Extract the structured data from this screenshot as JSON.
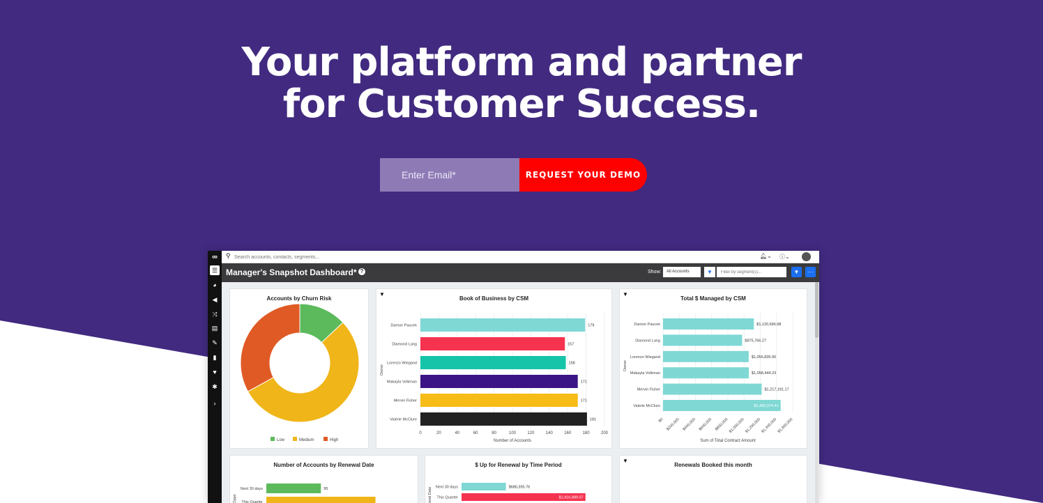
{
  "hero": {
    "title_line1": "Your platform and partner",
    "title_line2": "for Customer Success.",
    "email_placeholder": "Enter Email*",
    "cta_label": "REQUEST YOUR DEMO"
  },
  "colors": {
    "background": "#412a7f",
    "cta": "#ff0000",
    "email_bg": "#8e7bb6"
  },
  "app": {
    "search_placeholder": "Search accounts, contacts, segments...",
    "dashboard_title": "Manager's Snapshot Dashboard*",
    "show_label": "Show:",
    "show_select": "All Accounts",
    "segment_placeholder": "Filter by segment(s)...",
    "help_icon": "?",
    "topbar_icons": [
      "bell-icon",
      "question-icon",
      "avatar"
    ],
    "sidebar_icons": [
      "menu-icon",
      "dashboard-icon",
      "megaphone-icon",
      "shuffle-icon",
      "signpost-icon",
      "wrench-icon",
      "document-icon",
      "heart-icon",
      "gear-icon",
      "chevron-right-icon"
    ]
  },
  "panels": {
    "churn": {
      "title": "Accounts by Churn Risk"
    },
    "book": {
      "title": "Book of Business by CSM"
    },
    "managed": {
      "title": "Total $ Managed by CSM"
    },
    "renewal_date": {
      "title": "Number of Accounts by Renewal Date"
    },
    "renewal_period": {
      "title": "$ Up for Renewal by Time Period"
    },
    "booked": {
      "title": "Renewals Booked this month"
    }
  },
  "chart_data": [
    {
      "type": "pie",
      "title": "Accounts by Churn Risk",
      "categories": [
        "Low",
        "Medium",
        "High"
      ],
      "values": [
        13,
        54,
        33
      ],
      "colors": [
        "#5cba5c",
        "#f0b518",
        "#e05a25"
      ],
      "legend": "bottom"
    },
    {
      "type": "bar",
      "orientation": "horizontal",
      "title": "Book of Business by CSM",
      "categories": [
        "Damon Paucek",
        "Diamond Lang",
        "Lorenzo Wiegand",
        "Makayla Volkman",
        "Mervin Fisher",
        "Valerie McClure"
      ],
      "values": [
        179,
        157,
        158,
        171,
        171,
        181
      ],
      "colors": [
        "#7fd8d4",
        "#f5334f",
        "#16c5a9",
        "#3b1585",
        "#f7bc15",
        "#222222"
      ],
      "xlabel": "Number of Accounts",
      "ylabel": "Owner",
      "xlim": [
        0,
        200
      ],
      "xticks": [
        "0",
        "20",
        "40",
        "60",
        "80",
        "100",
        "120",
        "140",
        "160",
        "180",
        "200"
      ]
    },
    {
      "type": "bar",
      "orientation": "horizontal",
      "title": "Total $ Managed by CSM",
      "categories": [
        "Damon Paucek",
        "Diamond Lang",
        "Lorenzo Wiegand",
        "Makayla Volkman",
        "Mervin Fisher",
        "Valerie McClure"
      ],
      "values": [
        1120696.68,
        975766.27,
        1056839.9,
        1058444.23,
        1217191.17,
        1450974.41
      ],
      "value_labels": [
        "$1,120,696.68",
        "$975,766.27",
        "$1,056,839.90",
        "$1,058,444.23",
        "$1,217,191.17",
        "$1,450,974.41"
      ],
      "color": "#7fd8d4",
      "xlabel": "Sum of Total Contract Amount",
      "ylabel": "Owner",
      "xlim": [
        0,
        1600000
      ],
      "xticks": [
        "$0",
        "$200,000",
        "$400,000",
        "$600,000",
        "$800,000",
        "$1,000,000",
        "$1,200,000",
        "$1,400,000",
        "$1,600,000"
      ]
    },
    {
      "type": "bar",
      "orientation": "horizontal",
      "title": "Number of Accounts by Renewal Date",
      "categories": [
        "Next 30 days",
        "This Quarter"
      ],
      "values": [
        95,
        190
      ],
      "value_labels": [
        "95",
        ""
      ],
      "colors": [
        "#5cba5c",
        "#f0b518"
      ],
      "ylabel": "Opps",
      "xlim": [
        0,
        250
      ]
    },
    {
      "type": "bar",
      "orientation": "horizontal",
      "title": "$ Up for Renewal by Time Period",
      "categories": [
        "Next 30 days",
        "This Quarter"
      ],
      "values": [
        686355.76,
        1916889.07
      ],
      "value_labels": [
        "$686,355.76",
        "$1,916,889.07"
      ],
      "colors": [
        "#7fd8d4",
        "#f5334f"
      ],
      "ylabel": "Renewal Date",
      "xlim": [
        0,
        2200000
      ]
    }
  ]
}
